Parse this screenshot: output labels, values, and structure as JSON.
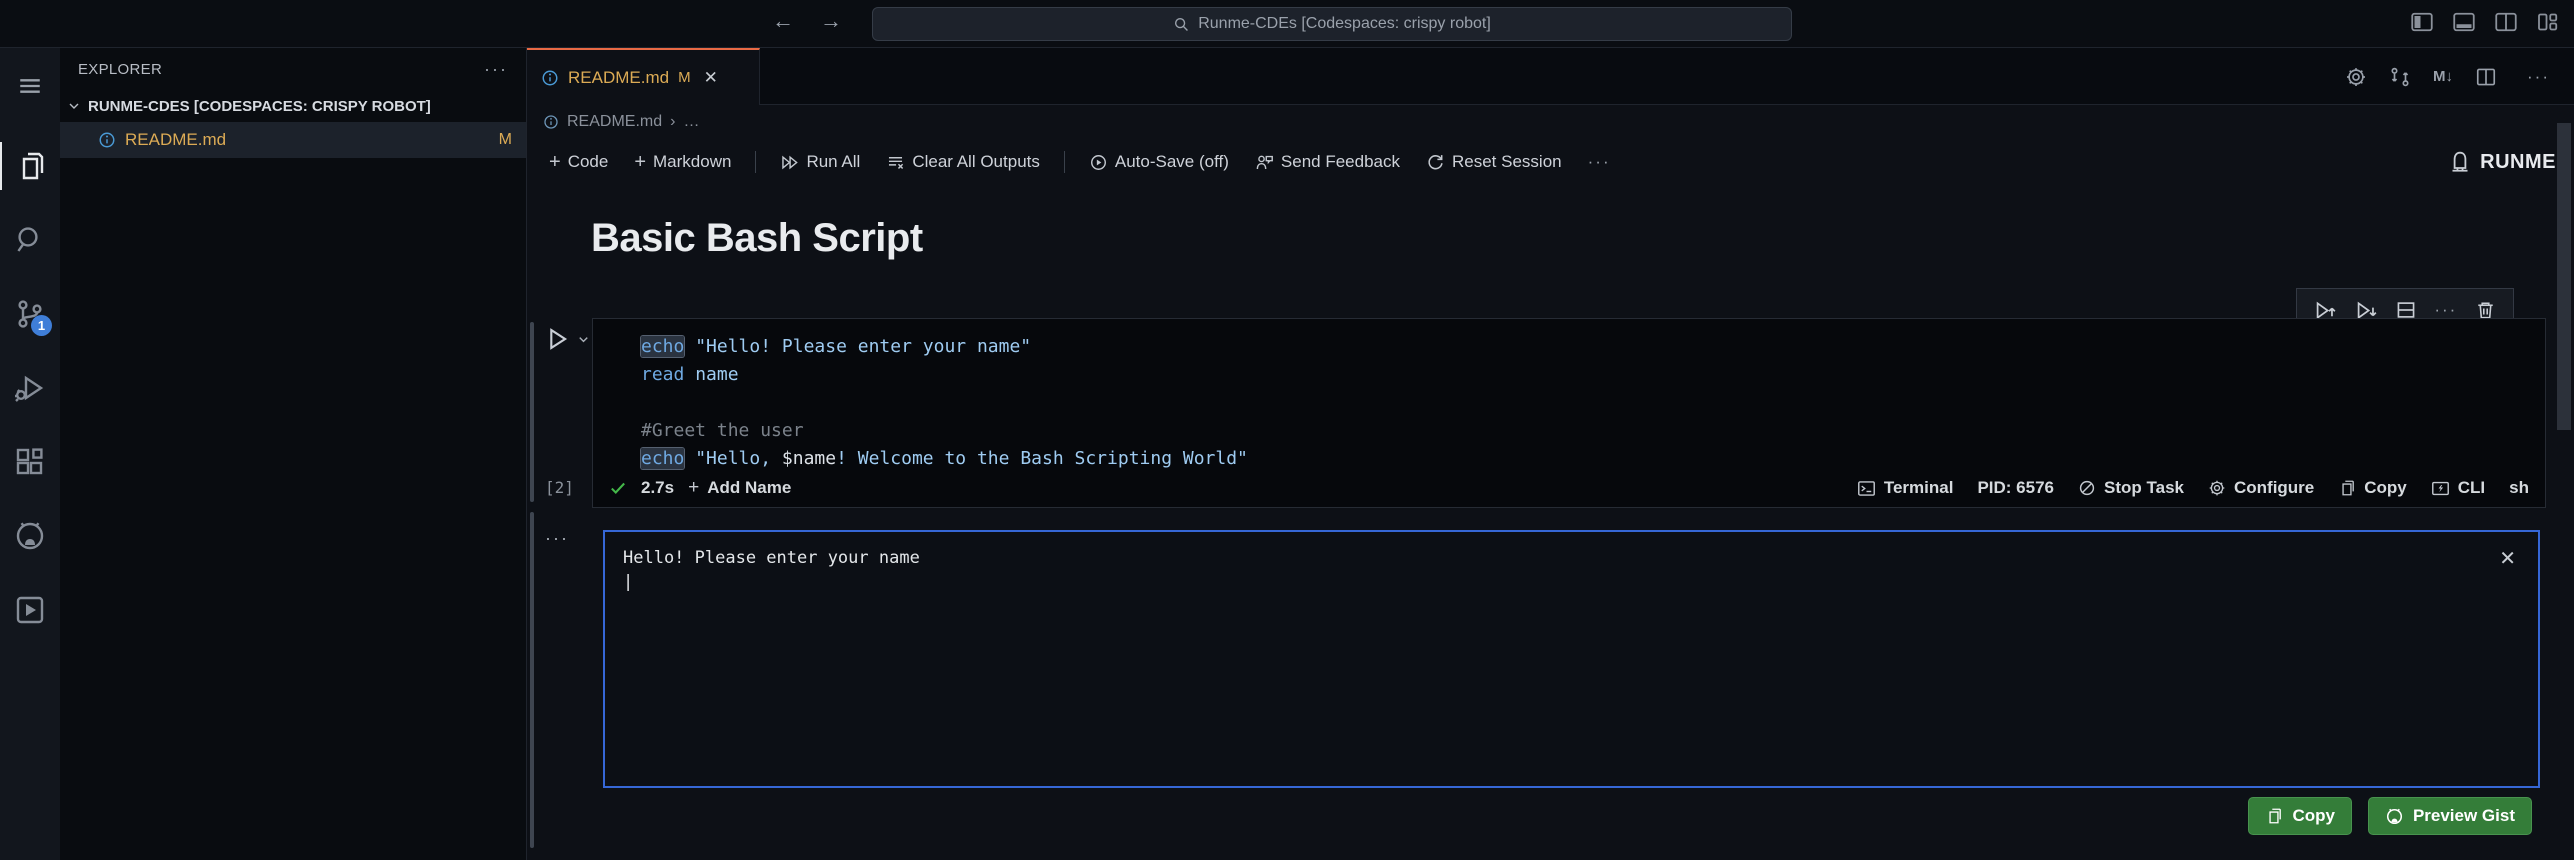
{
  "title_bar": {
    "search_text": "Runme-CDEs [Codespaces: crispy robot]",
    "back": "←",
    "forward": "→"
  },
  "activity_bar": {
    "scm_badge": "1"
  },
  "sidebar": {
    "header": "EXPLORER",
    "ellipsis": "···",
    "section_label": "RUNME-CDES [CODESPACES: CRISPY ROBOT]",
    "file_name": "README.md",
    "file_badge": "M"
  },
  "tab_bar": {
    "tab_label": "README.md",
    "tab_modified": "M",
    "close_glyph": "✕",
    "md_preview_glyph": "M↓",
    "more_glyph": "···"
  },
  "breadcrumb": {
    "file": "README.md",
    "sep": "›",
    "more": "…"
  },
  "toolbar": {
    "plus": "+",
    "code": "Code",
    "markdown": "Markdown",
    "run_all": "Run All",
    "clear_all": "Clear All Outputs",
    "auto_save": "Auto-Save (off)",
    "send_feedback": "Send Feedback",
    "reset_session": "Reset Session",
    "more_glyph": "···",
    "brand": "RUNME"
  },
  "document": {
    "heading": "Basic Bash Script"
  },
  "cell": {
    "exec_count": "[2]",
    "duration": "2.7s",
    "add_name_label": "Add Name",
    "status_right": {
      "terminal": "Terminal",
      "pid": "PID: 6576",
      "stop": "Stop Task",
      "configure": "Configure",
      "copy": "Copy",
      "cli": "CLI",
      "shell": "sh"
    },
    "ellipsis_glyph": "···",
    "code_lines": [
      [
        {
          "t": "echo",
          "c": "kw",
          "hl": true
        },
        {
          "t": " ",
          "c": "pln"
        },
        {
          "t": "\"Hello! Please enter your name\"",
          "c": "str"
        }
      ],
      [
        {
          "t": "read",
          "c": "kw"
        },
        {
          "t": " ",
          "c": "pln"
        },
        {
          "t": "name",
          "c": "str"
        }
      ],
      [],
      [
        {
          "t": "#Greet the user",
          "c": "com"
        }
      ],
      [
        {
          "t": "echo",
          "c": "kw",
          "hl": true
        },
        {
          "t": " ",
          "c": "pln"
        },
        {
          "t": "\"Hello, ",
          "c": "str"
        },
        {
          "t": "$name",
          "c": "var"
        },
        {
          "t": "! Welcome to the Bash Scripting World\"",
          "c": "str"
        }
      ]
    ]
  },
  "output": {
    "line": "Hello! Please enter your name",
    "cursor": "|",
    "close_glyph": "✕",
    "copy_button": "Copy",
    "preview_button": "Preview Gist"
  },
  "colors": {
    "tab_accent_orange": "#e96a45",
    "modified_gold": "#dcab55",
    "output_focus_blue": "#3667d6",
    "button_green": "#347d39",
    "scm_badge_blue": "#3f7ed8",
    "success_green": "#44b84a"
  }
}
